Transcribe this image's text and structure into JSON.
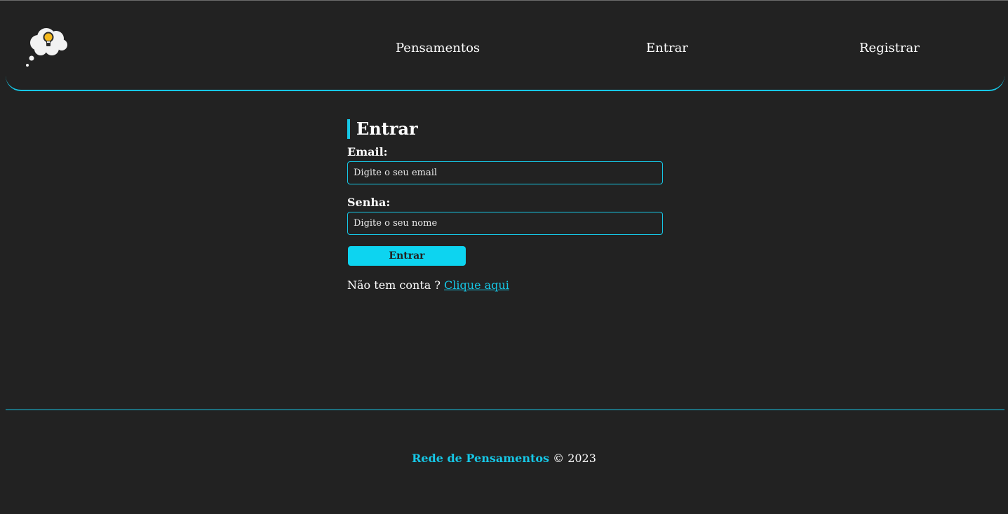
{
  "colors": {
    "background": "#222222",
    "accent": "#16c7e6",
    "button": "#0dd4f0",
    "text": "#ffffff"
  },
  "navbar": {
    "logo_icon": "thought-cloud-lightbulb-icon",
    "links": [
      {
        "label": "Pensamentos"
      },
      {
        "label": "Entrar"
      },
      {
        "label": "Registrar"
      }
    ]
  },
  "form": {
    "title": "Entrar",
    "email_label": "Email:",
    "email_placeholder": "Digite o seu email",
    "password_label": "Senha:",
    "password_placeholder": "Digite o seu nome",
    "submit_label": "Entrar",
    "register_prompt": "Não tem conta ?",
    "register_link": "Clique aqui"
  },
  "footer": {
    "brand": "Rede de Pensamentos",
    "copyright": "© 2023"
  }
}
